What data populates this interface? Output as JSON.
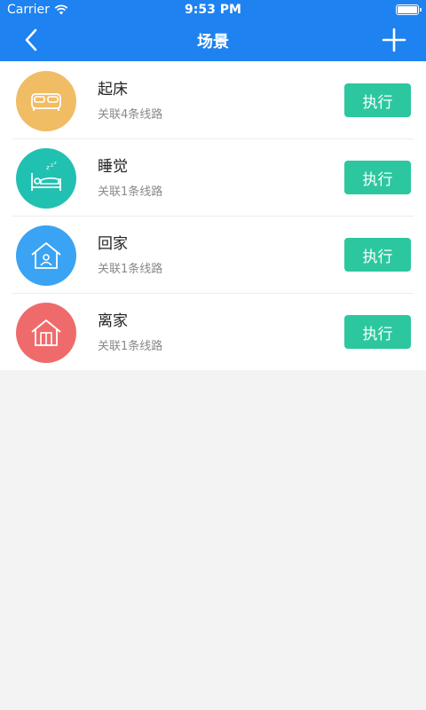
{
  "status_bar": {
    "carrier": "Carrier",
    "time": "9:53 PM"
  },
  "nav": {
    "title": "场景",
    "back_icon": "chevron-left-icon",
    "add_icon": "plus-icon"
  },
  "colors": {
    "primary": "#1e82f0",
    "execute_button": "#2cc79e",
    "wake": "#f0bc64",
    "sleep": "#21c1b1",
    "home": "#3aa3f3",
    "leave": "#ef6b6b"
  },
  "scenes": [
    {
      "name": "起床",
      "sub": "关联4条线路",
      "action": "执行",
      "icon": "bed-icon",
      "color": "#f0bc64"
    },
    {
      "name": "睡觉",
      "sub": "关联1条线路",
      "action": "执行",
      "icon": "sleeping-person-icon",
      "color": "#21c1b1"
    },
    {
      "name": "回家",
      "sub": "关联1条线路",
      "action": "执行",
      "icon": "home-person-icon",
      "color": "#3aa3f3"
    },
    {
      "name": "离家",
      "sub": "关联1条线路",
      "action": "执行",
      "icon": "home-door-icon",
      "color": "#ef6b6b"
    }
  ]
}
